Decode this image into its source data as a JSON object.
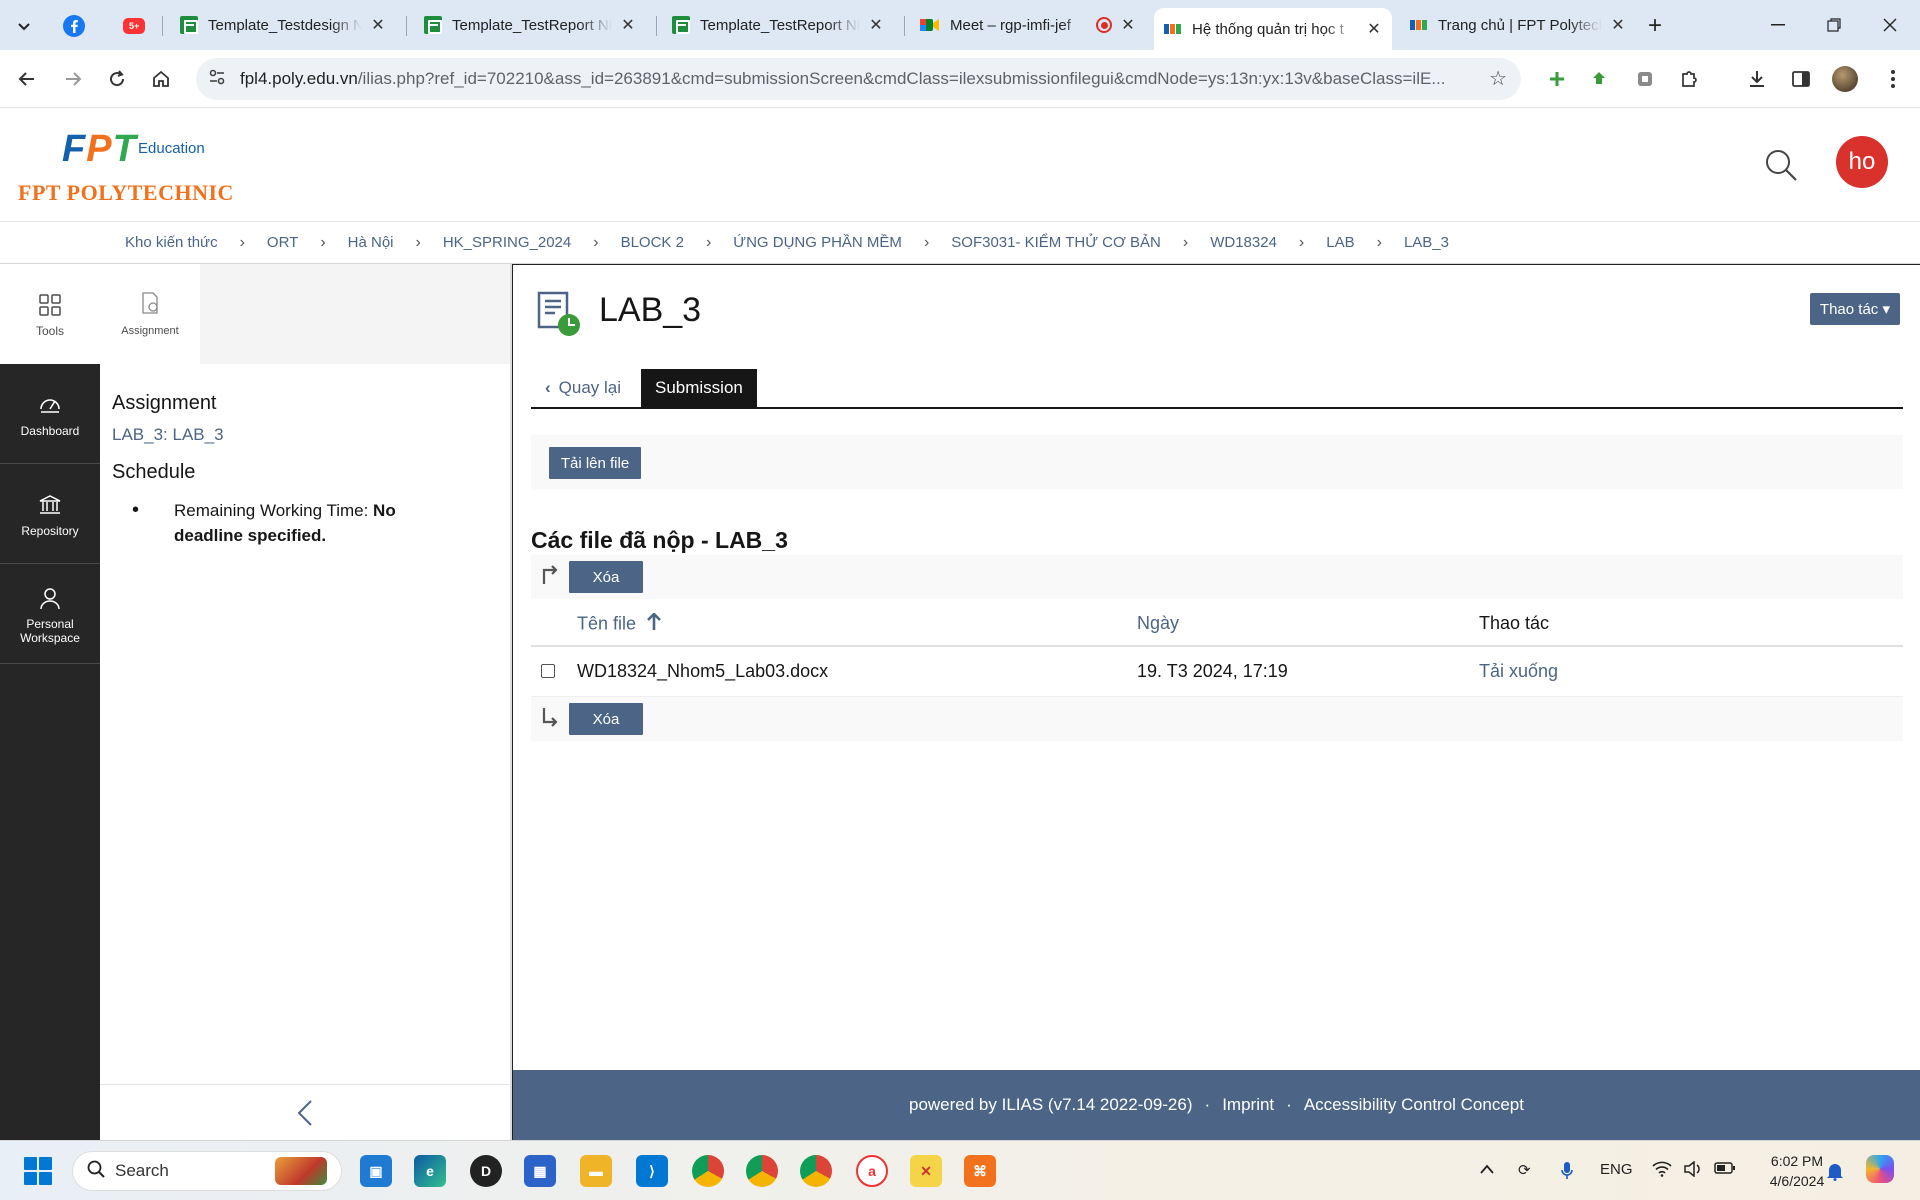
{
  "browser": {
    "tabs": [
      {
        "title": "Template_Testdesign Nh",
        "icon": "google-sheets-icon"
      },
      {
        "title": "Template_TestReport Nh",
        "icon": "google-sheets-icon"
      },
      {
        "title": "Template_TestReport Nh",
        "icon": "google-sheets-icon"
      },
      {
        "title": "Meet – rgp-imfi-jef",
        "icon": "google-meet-icon"
      },
      {
        "title": "Hệ thống quản trị học t",
        "icon": "fpt-icon",
        "active": true
      },
      {
        "title": "Trang chủ | FPT Polytech",
        "icon": "fpt-icon"
      }
    ],
    "pinned_badge": "5+",
    "url_host": "fpl4.poly.edu.vn",
    "url_path": "/ilias.php?ref_id=702210&ass_id=263891&cmd=submissionScreen&cmdClass=ilexsubmissionfilegui&cmdNode=ys:13n:yx:13v&baseClass=ilE..."
  },
  "header": {
    "logo_fpt": [
      "F",
      "P",
      "T"
    ],
    "logo_education": "Education",
    "logo_poly": "FPT POLYTECHNIC",
    "avatar_initials": "ho"
  },
  "breadcrumb": [
    "Kho kiến thức",
    "ORT",
    "Hà Nội",
    "HK_SPRING_2024",
    "BLOCK 2",
    "ỨNG DỤNG PHẦN MỀM",
    "SOF3031- KIỂM THỬ CƠ BẢN",
    "WD18324",
    "LAB",
    "LAB_3"
  ],
  "mainbar": {
    "tools": "Tools",
    "dashboard": "Dashboard",
    "repository": "Repository",
    "workspace_1": "Personal",
    "workspace_2": "Workspace"
  },
  "slate": {
    "tab_label": "Assignment",
    "heading": "Assignment",
    "link": "LAB_3: LAB_3",
    "schedule_heading": "Schedule",
    "remaining_label": "Remaining Working Time: ",
    "remaining_value_1": "No",
    "remaining_value_2": "deadline specified."
  },
  "content": {
    "title": "LAB_3",
    "actions_label": "Thao tác ▾",
    "back_tab": "Quay lại",
    "active_tab": "Submission",
    "upload_button": "Tải lên file",
    "section_title": "Các file đã nộp - LAB_3",
    "delete_button": "Xóa",
    "columns": {
      "filename": "Tên file",
      "date": "Ngày",
      "actions": "Thao tác"
    },
    "rows": [
      {
        "filename": "WD18324_Nhom5_Lab03.docx",
        "date": "19. T3 2024, 17:19",
        "action": "Tải xuống"
      }
    ]
  },
  "footer": {
    "powered": "powered by ILIAS (v7.14 2022-09-26)",
    "imprint": "Imprint",
    "accessibility": "Accessibility Control Concept"
  },
  "taskbar": {
    "search_placeholder": "Search",
    "language": "ENG",
    "time": "6:02 PM",
    "date": "4/6/2024"
  },
  "colors": {
    "ilias_blue": "#4c6586",
    "mainbar_dark": "#262626",
    "avatar_red": "#d9312b",
    "fpt_orange": "#f2711c"
  }
}
